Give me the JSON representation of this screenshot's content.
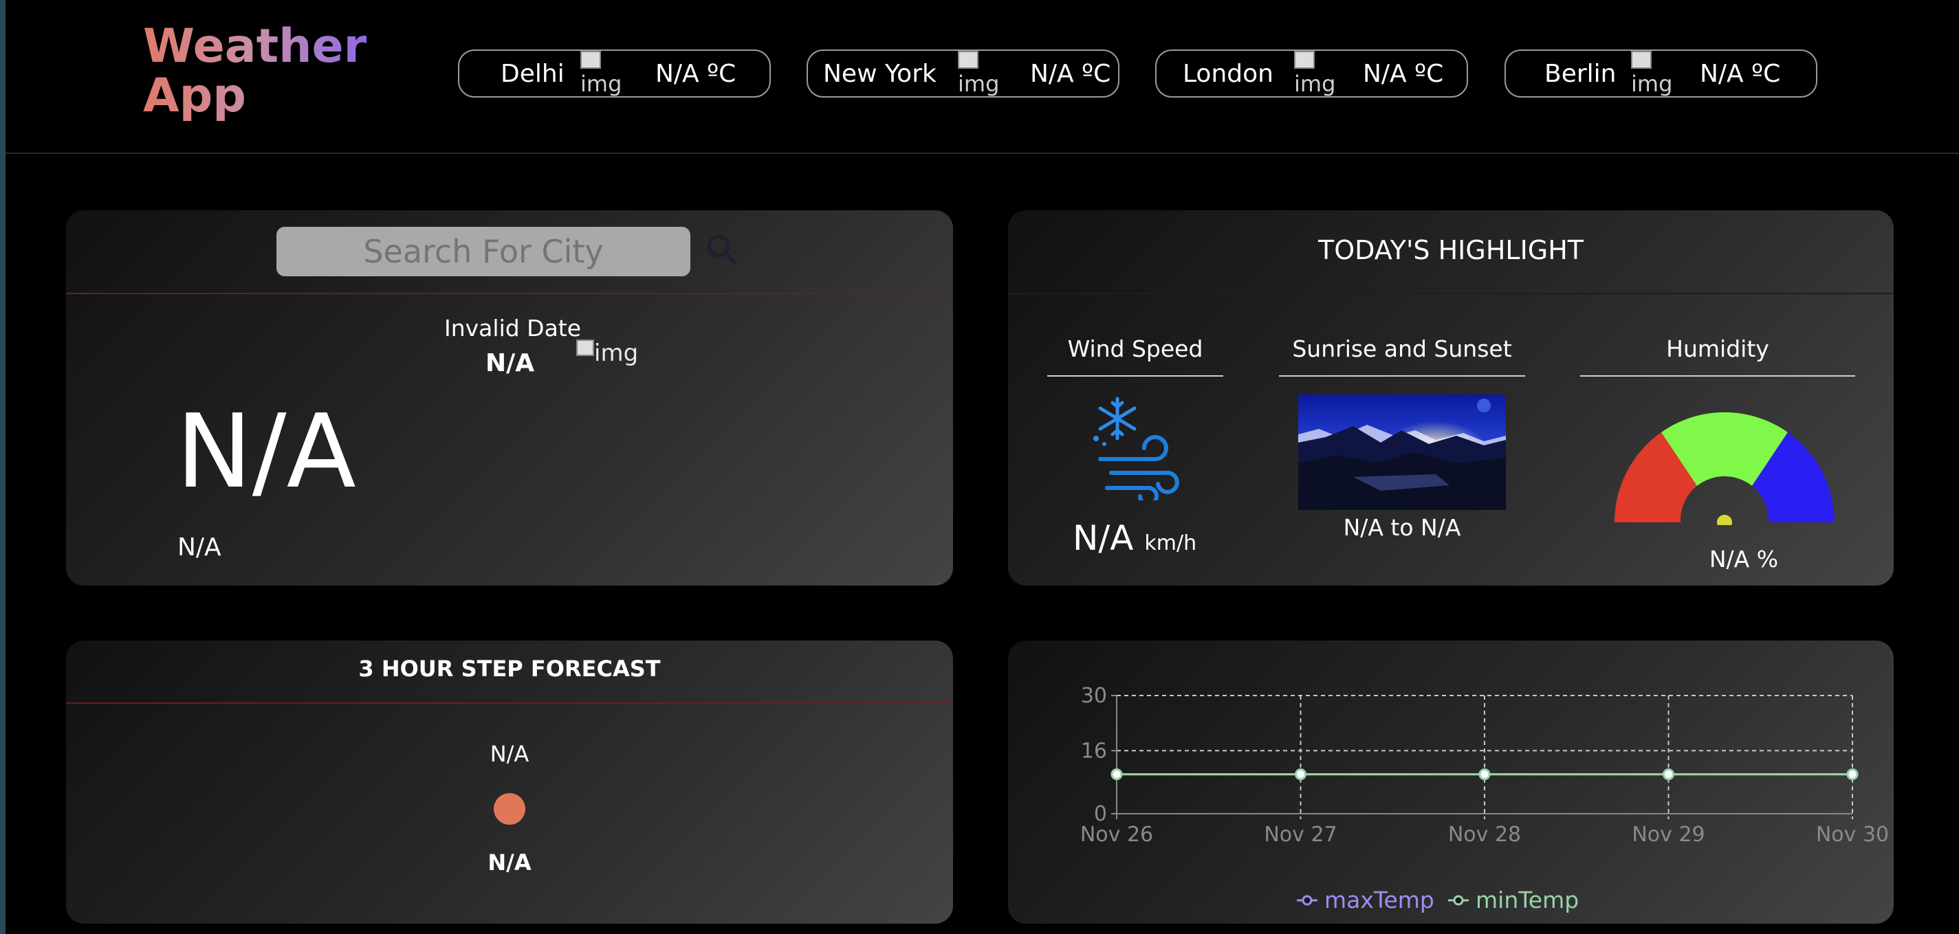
{
  "app": {
    "title_line1": "Weather",
    "title_line2": "App"
  },
  "header_cities": [
    {
      "name": "Delhi",
      "img_alt": "img",
      "temp": "N/A ºC"
    },
    {
      "name": "New York",
      "img_alt": "img",
      "temp": "N/A ºC"
    },
    {
      "name": "London",
      "img_alt": "img",
      "temp": "N/A ºC"
    },
    {
      "name": "Berlin",
      "img_alt": "img",
      "temp": "N/A ºC"
    }
  ],
  "search": {
    "placeholder": "Search For City",
    "icon": "search-icon"
  },
  "current": {
    "date": "Invalid Date",
    "day": "N/A",
    "img_alt": "img",
    "temperature": "N/A",
    "description": "N/A"
  },
  "highlight": {
    "title": "TODAY'S HIGHLIGHT",
    "wind": {
      "label": "Wind Speed",
      "value": "N/A",
      "unit": "km/h",
      "icon": "wind-snowflake-icon"
    },
    "sun": {
      "label": "Sunrise and Sunset",
      "value": "N/A to N/A"
    },
    "humidity": {
      "label": "Humidity",
      "value": "N/A %",
      "gauge_colors": [
        "#e03a2a",
        "#80f84a",
        "#2a1ef2"
      ]
    }
  },
  "forecast": {
    "title": "3 HOUR STEP FORECAST",
    "time": "N/A",
    "temp": "N/A",
    "dot_color": "#e07858"
  },
  "chart_data": {
    "type": "line",
    "x": [
      "Nov 26",
      "Nov 27",
      "Nov 28",
      "Nov 29",
      "Nov 30"
    ],
    "ylim": [
      0,
      30
    ],
    "yticks": [
      0,
      16,
      30
    ],
    "series": [
      {
        "name": "maxTemp",
        "color": "#a18cf0",
        "values": [
          10,
          10,
          10,
          10,
          10
        ]
      },
      {
        "name": "minTemp",
        "color": "#98d3a8",
        "values": [
          10,
          10,
          10,
          10,
          10
        ]
      }
    ],
    "grid": true,
    "legend_position": "bottom"
  }
}
